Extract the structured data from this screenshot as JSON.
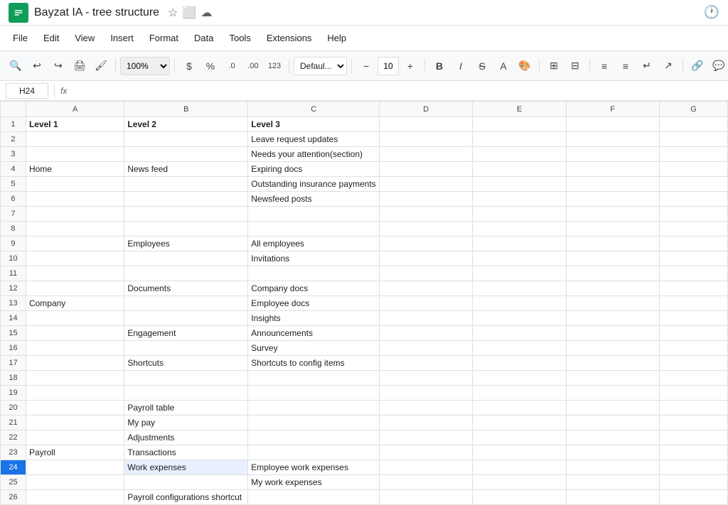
{
  "title": {
    "app_name": "Bayzat IA - tree structure",
    "star_icon": "★",
    "folder_icon": "📁",
    "cloud_icon": "☁",
    "history_icon": "🕐"
  },
  "menu": {
    "items": [
      "File",
      "Edit",
      "View",
      "Insert",
      "Format",
      "Data",
      "Tools",
      "Extensions",
      "Help"
    ]
  },
  "toolbar": {
    "zoom": "100%",
    "currency": "$",
    "percent": "%",
    "decimal_zero": ".0",
    "decimal_00": ".00",
    "format_123": "123",
    "font": "Defaul...",
    "font_size": "10"
  },
  "formula_bar": {
    "cell_ref": "H24",
    "fx": "fx"
  },
  "columns": {
    "row_header": "",
    "headers": [
      "",
      "A",
      "B",
      "C",
      "D",
      "E",
      "F",
      "G"
    ],
    "letters": [
      "A",
      "B",
      "C",
      "D",
      "E",
      "F",
      "G"
    ]
  },
  "rows": [
    {
      "num": 1,
      "a": "Level 1",
      "b": "Level 2",
      "c": "Level 3",
      "d": "",
      "e": "",
      "f": "",
      "g": "",
      "header": true
    },
    {
      "num": 2,
      "a": "",
      "b": "",
      "c": "Leave request updates",
      "d": "",
      "e": "",
      "f": "",
      "g": ""
    },
    {
      "num": 3,
      "a": "",
      "b": "",
      "c": "Needs your attention(section)",
      "d": "",
      "e": "",
      "f": "",
      "g": ""
    },
    {
      "num": 4,
      "a": "Home",
      "b": "News feed",
      "c": "Expiring docs",
      "d": "",
      "e": "",
      "f": "",
      "g": ""
    },
    {
      "num": 5,
      "a": "",
      "b": "",
      "c": "Outstanding insurance payments",
      "d": "",
      "e": "",
      "f": "",
      "g": ""
    },
    {
      "num": 6,
      "a": "",
      "b": "",
      "c": "Newsfeed posts",
      "d": "",
      "e": "",
      "f": "",
      "g": ""
    },
    {
      "num": 7,
      "a": "",
      "b": "",
      "c": "",
      "d": "",
      "e": "",
      "f": "",
      "g": ""
    },
    {
      "num": 8,
      "a": "",
      "b": "",
      "c": "",
      "d": "",
      "e": "",
      "f": "",
      "g": ""
    },
    {
      "num": 9,
      "a": "",
      "b": "Employees",
      "c": "All employees",
      "d": "",
      "e": "",
      "f": "",
      "g": ""
    },
    {
      "num": 10,
      "a": "",
      "b": "",
      "c": "Invitations",
      "d": "",
      "e": "",
      "f": "",
      "g": ""
    },
    {
      "num": 11,
      "a": "",
      "b": "",
      "c": "",
      "d": "",
      "e": "",
      "f": "",
      "g": ""
    },
    {
      "num": 12,
      "a": "",
      "b": "Documents",
      "c": "Company docs",
      "d": "",
      "e": "",
      "f": "",
      "g": ""
    },
    {
      "num": 13,
      "a": "Company",
      "b": "",
      "c": "Employee docs",
      "d": "",
      "e": "",
      "f": "",
      "g": ""
    },
    {
      "num": 14,
      "a": "",
      "b": "",
      "c": "Insights",
      "d": "",
      "e": "",
      "f": "",
      "g": ""
    },
    {
      "num": 15,
      "a": "",
      "b": "Engagement",
      "c": "Announcements",
      "d": "",
      "e": "",
      "f": "",
      "g": ""
    },
    {
      "num": 16,
      "a": "",
      "b": "",
      "c": "Survey",
      "d": "",
      "e": "",
      "f": "",
      "g": ""
    },
    {
      "num": 17,
      "a": "",
      "b": "Shortcuts",
      "c": "Shortcuts to config items",
      "d": "",
      "e": "",
      "f": "",
      "g": ""
    },
    {
      "num": 18,
      "a": "",
      "b": "",
      "c": "",
      "d": "",
      "e": "",
      "f": "",
      "g": ""
    },
    {
      "num": 19,
      "a": "",
      "b": "",
      "c": "",
      "d": "",
      "e": "",
      "f": "",
      "g": ""
    },
    {
      "num": 20,
      "a": "",
      "b": "Payroll table",
      "c": "",
      "d": "",
      "e": "",
      "f": "",
      "g": ""
    },
    {
      "num": 21,
      "a": "",
      "b": "My pay",
      "c": "",
      "d": "",
      "e": "",
      "f": "",
      "g": ""
    },
    {
      "num": 22,
      "a": "",
      "b": "Adjustments",
      "c": "",
      "d": "",
      "e": "",
      "f": "",
      "g": ""
    },
    {
      "num": 23,
      "a": "Payroll",
      "b": "Transactions",
      "c": "",
      "d": "",
      "e": "",
      "f": "",
      "g": ""
    },
    {
      "num": 24,
      "a": "",
      "b": "Work expenses",
      "c": "Employee work expenses",
      "d": "",
      "e": "",
      "f": "",
      "g": "",
      "selected": true
    },
    {
      "num": 25,
      "a": "",
      "b": "",
      "c": "My work expenses",
      "d": "",
      "e": "",
      "f": "",
      "g": ""
    },
    {
      "num": 26,
      "a": "",
      "b": "Payroll configurations shortcut",
      "c": "",
      "d": "",
      "e": "",
      "f": "",
      "g": ""
    }
  ],
  "colors": {
    "selected_blue": "#1a73e8",
    "header_bg": "#f8f9fa",
    "border": "#e0e0e0",
    "text": "#202124"
  }
}
